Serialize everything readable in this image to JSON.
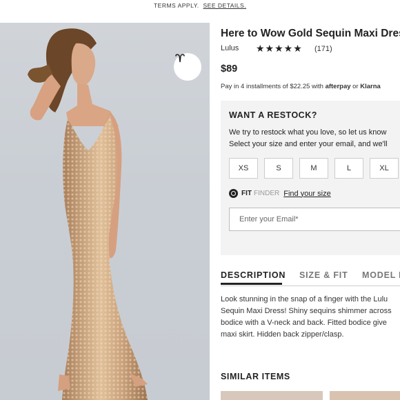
{
  "topbar": {
    "text": "TERMS APPLY.",
    "link": "SEE DETAILS."
  },
  "product": {
    "title": "Here to Wow Gold Sequin Maxi Dress",
    "brand": "Lulus",
    "stars": "★★★★★",
    "rating": 4.5,
    "reviews": "(171)",
    "price": "$89"
  },
  "installments": {
    "text": "Pay in 4 installments of $22.25 with",
    "provider1": "afterpay",
    "or": "or",
    "provider2": "Klarna"
  },
  "restock": {
    "title": "WANT A RESTOCK?",
    "line1": "We try to restock what you love, so let us know",
    "line2": "Select your size and enter your email, and we'll",
    "sizes": [
      "XS",
      "S",
      "M",
      "L",
      "XL"
    ],
    "fit_word": "FIT",
    "finder_word": "FINDER",
    "fit_link": "Find your size",
    "email_placeholder": "Enter your Email*"
  },
  "tabs": [
    "DESCRIPTION",
    "SIZE & FIT",
    "MODEL I"
  ],
  "description": [
    "Look stunning in the snap of a finger with the Lulu",
    "Sequin Maxi Dress! Shiny sequins shimmer across",
    "bodice with a V-neck and back. Fitted bodice give",
    "maxi skirt. Hidden back zipper/clasp."
  ],
  "similar_title": "SIMILAR ITEMS",
  "colors": {
    "accent": "#222222",
    "panel": "#f3f3f3",
    "photo_bg": "#c9ced4",
    "dress": "#c9a27e"
  },
  "icons": [
    "heart-icon",
    "star-icon",
    "fit-finder-icon"
  ]
}
